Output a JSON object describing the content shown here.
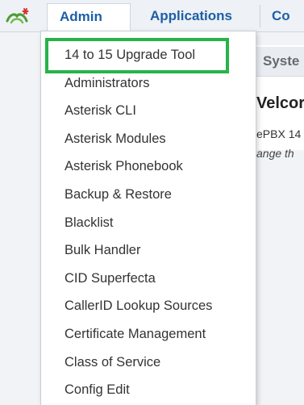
{
  "navbar": {
    "items": [
      {
        "label": "Admin"
      },
      {
        "label": "Applications"
      },
      {
        "label": "Co"
      }
    ],
    "accent_color": "#1d5fa6"
  },
  "background": {
    "panel_tab": "Syste",
    "welcome": "Velcor",
    "pbx": "ePBX 14",
    "change": "ange th"
  },
  "admin_menu": {
    "highlight_color": "#27b34a",
    "items": [
      {
        "label": "14 to 15 Upgrade Tool"
      },
      {
        "label": "Administrators"
      },
      {
        "label": "Asterisk CLI"
      },
      {
        "label": "Asterisk Modules"
      },
      {
        "label": "Asterisk Phonebook"
      },
      {
        "label": "Backup & Restore"
      },
      {
        "label": "Blacklist"
      },
      {
        "label": "Bulk Handler"
      },
      {
        "label": "CID Superfecta"
      },
      {
        "label": "CallerID Lookup Sources"
      },
      {
        "label": "Certificate Management"
      },
      {
        "label": "Class of Service"
      },
      {
        "label": "Config Edit"
      }
    ]
  }
}
